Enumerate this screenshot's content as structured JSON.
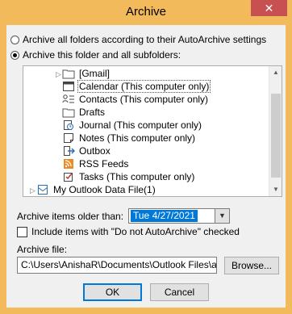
{
  "window": {
    "title": "Archive",
    "close_glyph": "✕"
  },
  "options": {
    "archive_all_label": "Archive all folders according to their AutoArchive settings",
    "archive_folder_label": "Archive this folder and all subfolders:",
    "selected": "archive_folder"
  },
  "tree": {
    "items": [
      {
        "label": "[Gmail]",
        "icon": "folder-icon",
        "expandable": true
      },
      {
        "label": "Calendar (This computer only)",
        "icon": "calendar-icon",
        "selected": true
      },
      {
        "label": "Contacts (This computer only)",
        "icon": "contacts-icon"
      },
      {
        "label": "Drafts",
        "icon": "folder-icon"
      },
      {
        "label": "Journal (This computer only)",
        "icon": "journal-icon"
      },
      {
        "label": "Notes (This computer only)",
        "icon": "notes-icon"
      },
      {
        "label": "Outbox",
        "icon": "outbox-icon"
      },
      {
        "label": "RSS Feeds",
        "icon": "rss-icon"
      },
      {
        "label": "Tasks (This computer only)",
        "icon": "tasks-icon"
      },
      {
        "label": "My Outlook Data File(1)",
        "icon": "data-file-icon",
        "expandable": true
      }
    ]
  },
  "archive_older": {
    "label": "Archive items older than:",
    "value": "Tue 4/27/2021"
  },
  "include_no_autoarchive": {
    "label": "Include items with \"Do not AutoArchive\" checked",
    "checked": false
  },
  "archive_file": {
    "label": "Archive file:",
    "value": "C:\\Users\\AnishaR\\Documents\\Outlook Files\\archive.pst",
    "browse_label": "Browse..."
  },
  "buttons": {
    "ok": "OK",
    "cancel": "Cancel"
  },
  "colors": {
    "window_frame": "#f2ba5a",
    "selection": "#0078d7",
    "close_button": "#c75050"
  }
}
